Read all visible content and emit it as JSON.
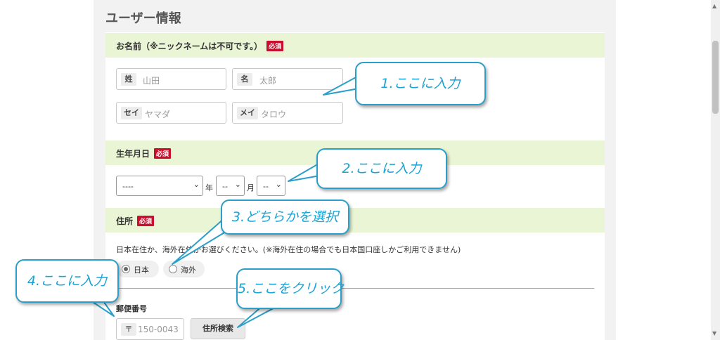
{
  "page_title": "ユーザー情報",
  "name_section": {
    "label": "お名前（※ニックネームは不可です。）",
    "required": "必須",
    "last_name": {
      "tag": "姓",
      "placeholder": "山田"
    },
    "first_name": {
      "tag": "名",
      "placeholder": "太郎"
    },
    "last_kana": {
      "tag": "セイ",
      "placeholder": "ヤマダ"
    },
    "first_kana": {
      "tag": "メイ",
      "placeholder": "タロウ"
    }
  },
  "birth_section": {
    "label": "生年月日",
    "required": "必須",
    "year": {
      "value": "----",
      "unit": "年"
    },
    "month": {
      "value": "--",
      "unit": "月"
    },
    "day": {
      "value": "--"
    }
  },
  "address_section": {
    "label": "住所",
    "required": "必須",
    "note": "日本在住か、海外在住かお選びください。(※海外在住の場合でも日本国口座しかご利用できません)",
    "options": [
      {
        "label": "日本",
        "checked": true
      },
      {
        "label": "海外",
        "checked": false
      }
    ],
    "postal_label": "郵便番号",
    "postal_mark": "〒",
    "postal_placeholder": "150-0043",
    "search_button": "住所検索"
  },
  "callouts": [
    "1.ここに入力",
    "2.ここに入力",
    "3.どちらかを選択",
    "4.ここに入力",
    "5.ここをクリック"
  ],
  "colors": {
    "section_bg": "#e9f5d5",
    "required_badge": "#c8102e",
    "callout": "#1aa3d6"
  }
}
